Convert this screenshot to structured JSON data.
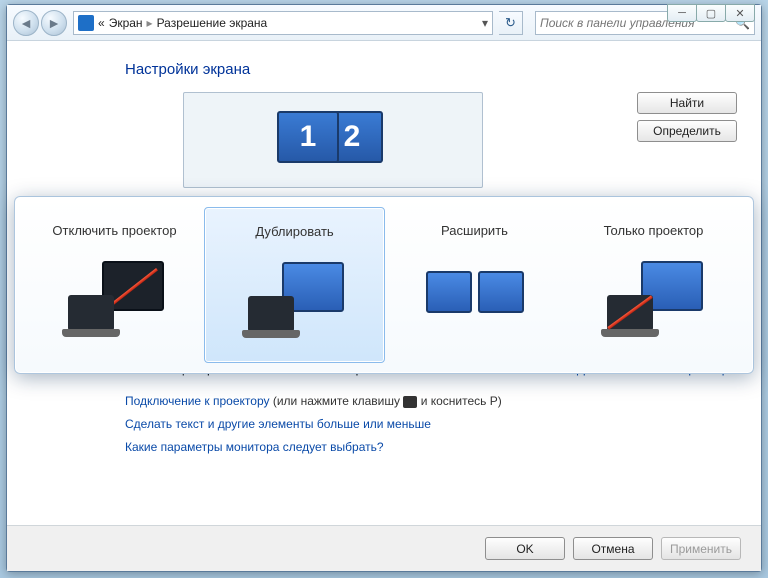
{
  "breadcrumb": {
    "prefix": "«",
    "item1": "Экран",
    "item2": "Разрешение экрана"
  },
  "search": {
    "placeholder": "Поиск в панели управления"
  },
  "page": {
    "title": "Настройки экрана"
  },
  "monitors": {
    "m1": "1",
    "m2": "2"
  },
  "sideButtons": {
    "find": "Найти",
    "identify": "Определить"
  },
  "projector": {
    "opt1": "Отключить проектор",
    "opt2": "Дублировать",
    "opt3": "Расширить",
    "opt4": "Только проектор",
    "selected": 2
  },
  "status": {
    "text": "В настоящее время это основной монитор.",
    "advanced": "Дополнительные параметры"
  },
  "links": {
    "connect": "Подключение к проектору",
    "connect_note_pre": " (или нажмите клавишу ",
    "connect_note_post": " и коснитесь P)",
    "resize": "Сделать текст и другие элементы больше или меньше",
    "which": "Какие параметры монитора следует выбрать?"
  },
  "buttons": {
    "ok": "OK",
    "cancel": "Отмена",
    "apply": "Применить"
  }
}
